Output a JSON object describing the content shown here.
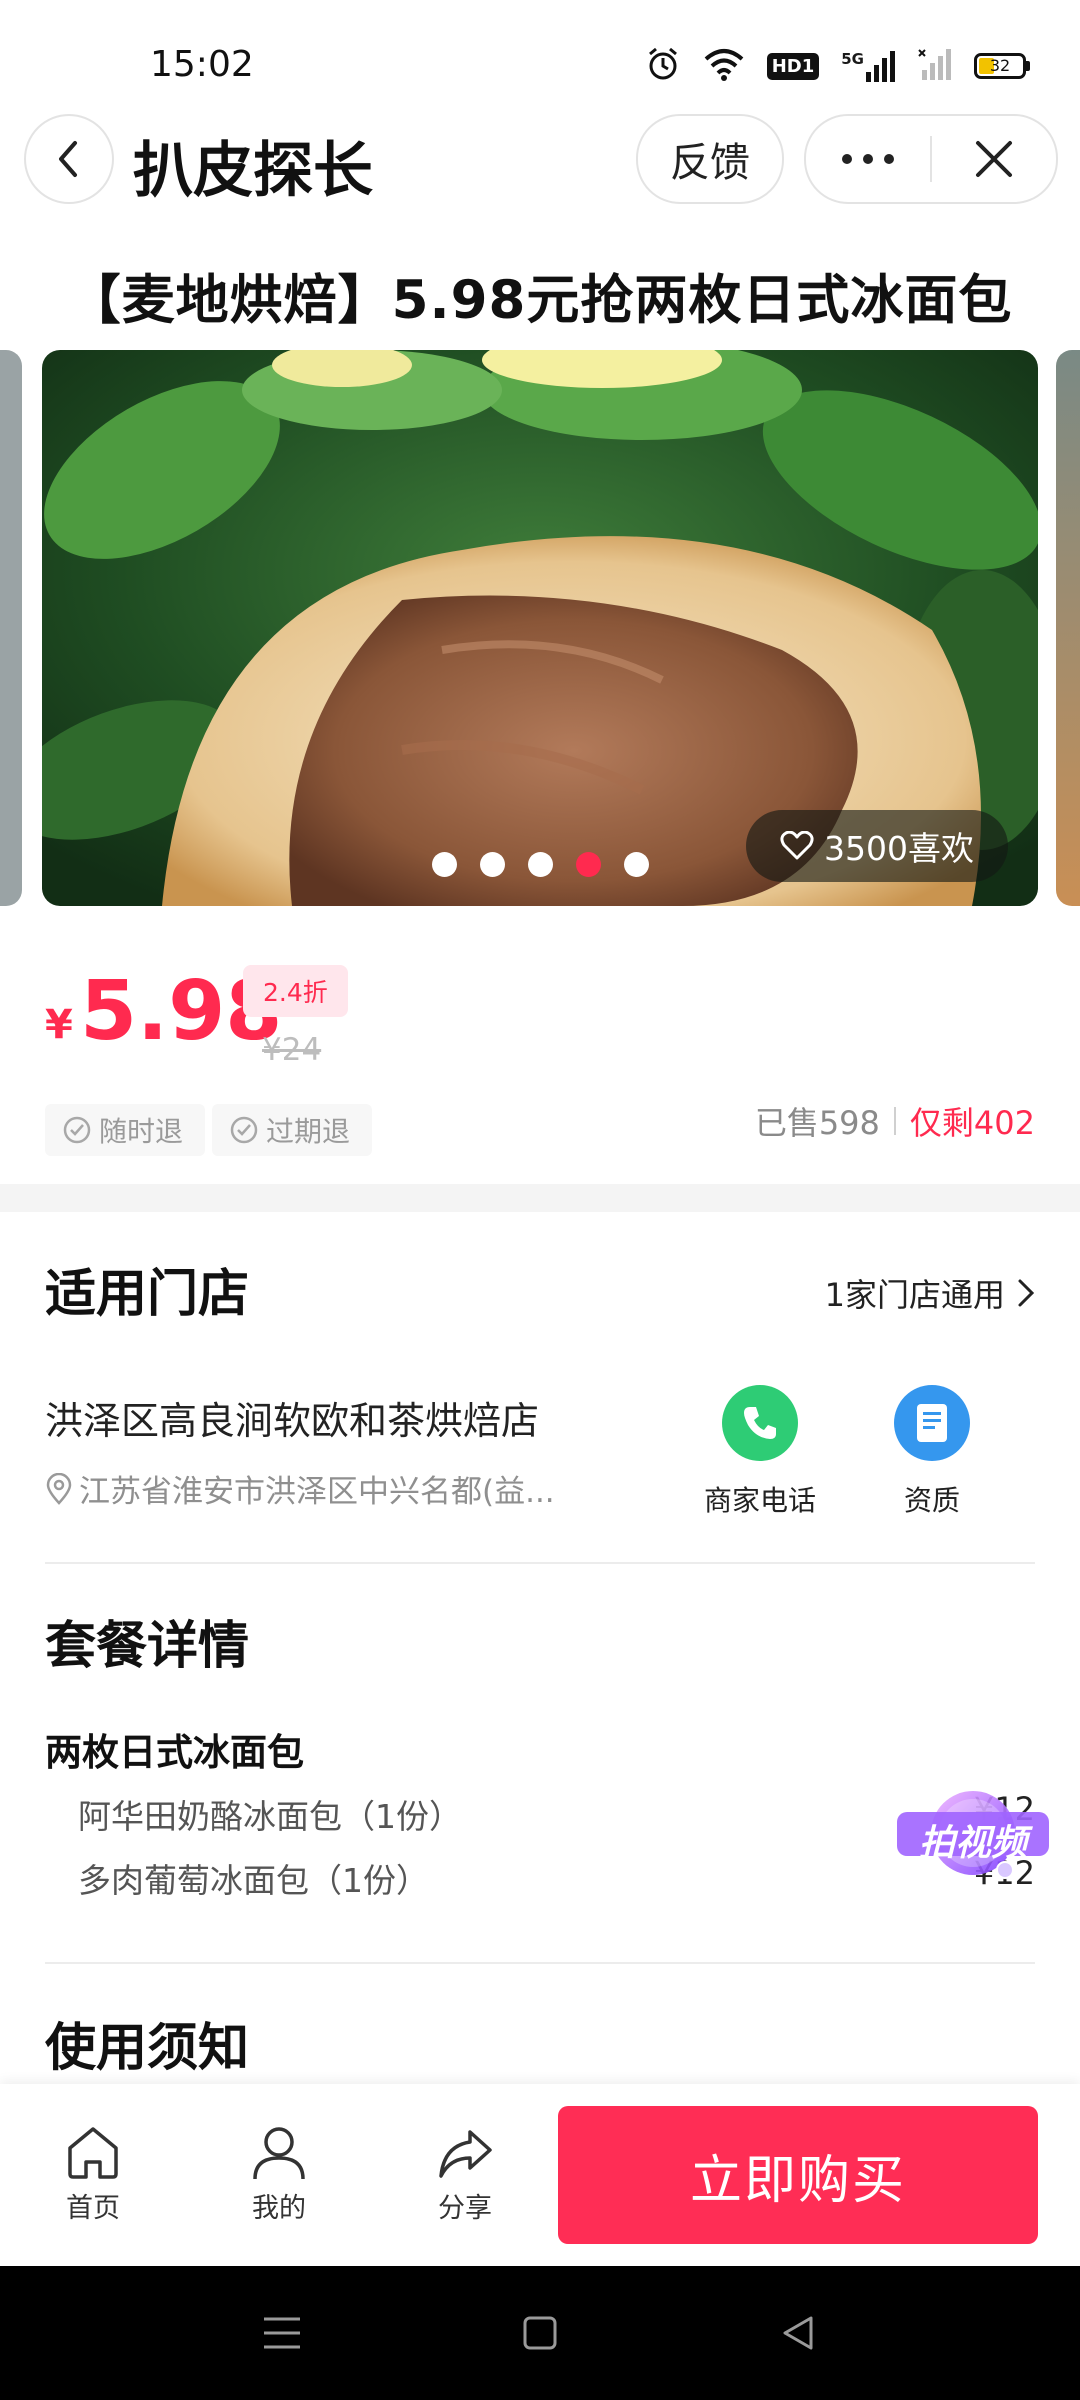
{
  "status_bar": {
    "time": "15:02",
    "battery": "32",
    "network": "5G",
    "hd": "HD1"
  },
  "header": {
    "title": "扒皮探长",
    "feedback_label": "反馈"
  },
  "deal": {
    "title": "【麦地烘焙】5.98元抢两枚日式冰面包"
  },
  "carousel": {
    "like_text": "3500喜欢",
    "slide_count": 5,
    "active_slide": 4
  },
  "price": {
    "currency": "¥",
    "current": "5.98",
    "discount": "2.4折",
    "original": "¥24",
    "guarantees": [
      "随时退",
      "过期退"
    ],
    "sold": "已售598",
    "remaining": "仅剩402"
  },
  "stores": {
    "title": "适用门店",
    "link": "1家门店通用",
    "name": "洪泽区高良涧软欧和茶烘焙店",
    "address": "江苏省淮安市洪泽区中兴名都(益...",
    "call_label": "商家电话",
    "license_label": "资质"
  },
  "package": {
    "title": "套餐详情",
    "name": "两枚日式冰面包",
    "items": [
      {
        "name": "阿华田奶酪冰面包（1份）",
        "price": "¥12"
      },
      {
        "name": "多肉葡萄冰面包（1份）",
        "price": "¥12"
      }
    ],
    "video_badge": "拍视频"
  },
  "notice": {
    "title": "使用须知"
  },
  "bottom_nav": {
    "home": "首页",
    "mine": "我的",
    "share": "分享",
    "buy": "立即购买"
  },
  "colors": {
    "accent": "#ff2a4f",
    "buy_button": "#ff2d55",
    "phone_green": "#2ecc75",
    "doc_blue": "#3597ee"
  }
}
